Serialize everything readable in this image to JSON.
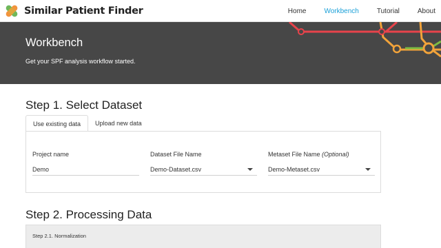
{
  "app": {
    "title": "Similar Patient Finder"
  },
  "nav": {
    "items": [
      {
        "label": "Home",
        "active": false
      },
      {
        "label": "Workbench",
        "active": true
      },
      {
        "label": "Tutorial",
        "active": false
      },
      {
        "label": "About",
        "active": false
      }
    ]
  },
  "hero": {
    "title": "Workbench",
    "subtitle": "Get your SPF analysis workflow started."
  },
  "step1": {
    "heading": "Step 1. Select Dataset",
    "tabs": [
      {
        "label": "Use existing data",
        "active": true
      },
      {
        "label": "Upload new data",
        "active": false
      }
    ],
    "fields": {
      "project": {
        "label": "Project name",
        "value": "Demo"
      },
      "dataset": {
        "label": "Dataset File Name",
        "value": "Demo-Dataset.csv"
      },
      "metaset": {
        "label": "Metaset File Name",
        "label_suffix": "(Optional)",
        "value": "Demo-Metaset.csv"
      }
    }
  },
  "step2": {
    "heading": "Step 2. Processing Data",
    "subpanel_title": "Step 2.1. Normalization"
  },
  "colors": {
    "nav_active": "#1aa0d8",
    "hero_bg": "#474747",
    "line_red": "#e8434b",
    "line_orange": "#f2a33a",
    "line_green": "#7dbb42"
  },
  "icons": {
    "logo": "logo-icon",
    "dropdown": "chevron-down-icon"
  }
}
